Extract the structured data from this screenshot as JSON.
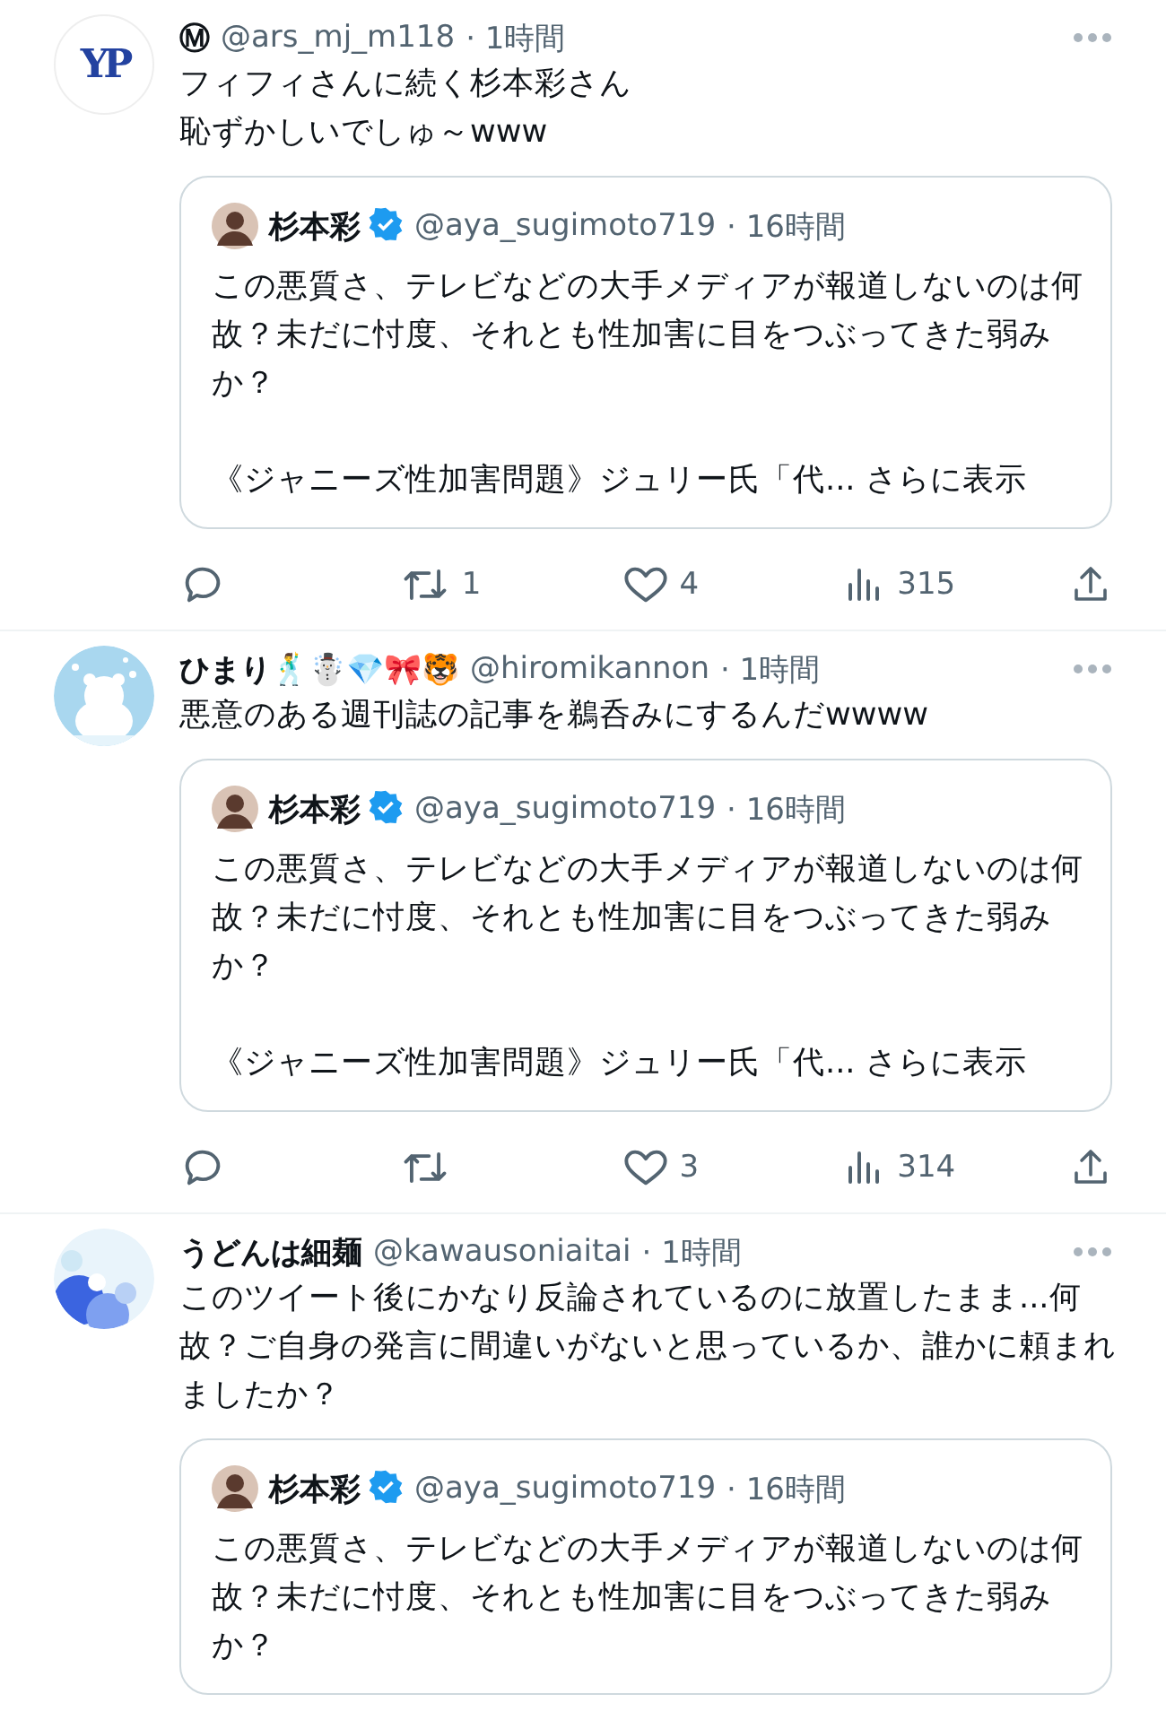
{
  "tweets": [
    {
      "avatar": {
        "kind": "logo",
        "text": "YP"
      },
      "name": "Ⓜ",
      "handle": "@ars_mj_m118",
      "time": "· 1時間",
      "lines": [
        "フィフィさんに続く杉本彩さん",
        "恥ずかしいでしゅ～www"
      ],
      "quote": {
        "name": "杉本彩",
        "verified": true,
        "handle": "@aya_sugimoto719",
        "time": "· 16時間",
        "text": "この悪質さ、テレビなどの大手メディアが報道しないのは何故？未だに忖度、それとも性加害に目をつぶってきた弱みか？",
        "link_line": "《ジャニーズ性加害問題》ジュリー氏「代...",
        "more": "さらに表示"
      },
      "actions": {
        "retweets": "1",
        "likes": "4",
        "views": "315"
      }
    },
    {
      "avatar": {
        "kind": "picture"
      },
      "name": "ひまり🕺☃️💎🎀🐯",
      "handle": "@hiromikannon",
      "time": "· 1時間",
      "lines": [
        "悪意のある週刊誌の記事を鵜呑みにするんだwwww"
      ],
      "quote": {
        "name": "杉本彩",
        "verified": true,
        "handle": "@aya_sugimoto719",
        "time": "· 16時間",
        "text": "この悪質さ、テレビなどの大手メディアが報道しないのは何故？未だに忖度、それとも性加害に目をつぶってきた弱みか？",
        "link_line": "《ジャニーズ性加害問題》ジュリー氏「代...",
        "more": "さらに表示"
      },
      "actions": {
        "likes": "3",
        "views": "314"
      }
    },
    {
      "avatar": {
        "kind": "picture"
      },
      "name": "うどんは細麺",
      "handle": "@kawausoniaitai",
      "time": "· 1時間",
      "lines": [
        "このツイート後にかなり反論されているのに放置したまま...何故？ご自身の発言に間違いがないと思っているか、誰かに頼まれましたか？"
      ],
      "quote": {
        "name": "杉本彩",
        "verified": true,
        "handle": "@aya_sugimoto719",
        "time": "· 16時間",
        "text": "この悪質さ、テレビなどの大手メディアが報道しないのは何故？未だに忖度、それとも性加害に目をつぶってきた弱みか？"
      }
    }
  ]
}
